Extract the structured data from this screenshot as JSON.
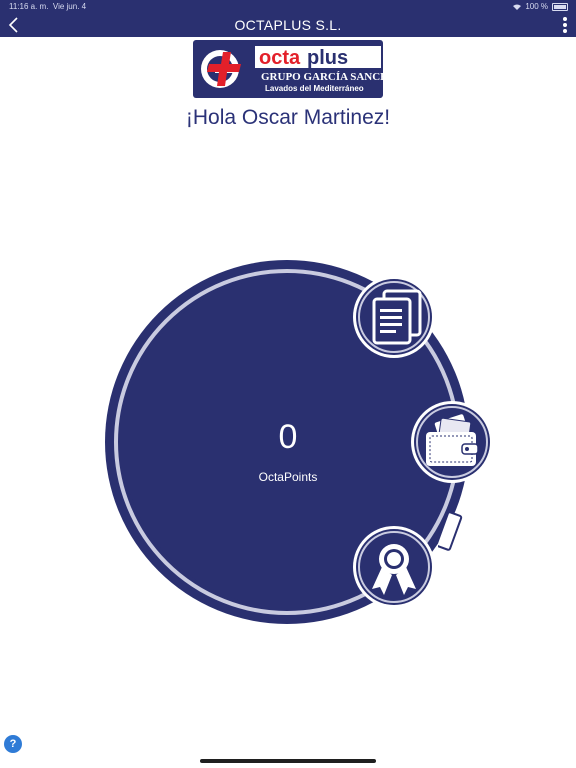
{
  "status_bar": {
    "time": "11:16 a. m.",
    "date": "Vie jun. 4",
    "battery": "100 %"
  },
  "header": {
    "title": "OCTAPLUS S.L."
  },
  "logo": {
    "brand_octa": "octa",
    "brand_plus": "plus",
    "group_name": "GRUPO GARCÍA SANCHIS",
    "tagline": "Lavados del Mediterráneo"
  },
  "greeting": "¡Hola Oscar Martinez!",
  "points": {
    "value": "0",
    "label": "OctaPoints"
  },
  "help": {
    "label": "?"
  },
  "colors": {
    "primary": "#2a3070",
    "accent_red": "#e3202a",
    "ring_light": "#c9cbe0"
  }
}
